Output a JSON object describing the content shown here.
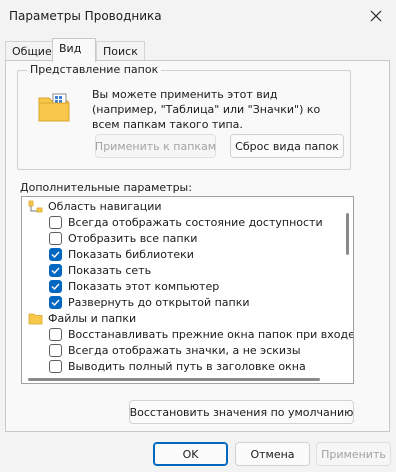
{
  "window": {
    "title": "Параметры Проводника",
    "close_icon": "close-icon"
  },
  "tabs": [
    {
      "label": "Общие",
      "active": false
    },
    {
      "label": "Вид",
      "active": true
    },
    {
      "label": "Поиск",
      "active": false
    }
  ],
  "folder_view": {
    "group_title": "Представление папок",
    "description": "Вы можете применить этот вид (например, \"Таблица\" или \"Значки\") ко всем папкам такого типа.",
    "apply_label": "Применить к папкам",
    "reset_label": "Сброс вида папок",
    "icon": "folder-view-icon"
  },
  "advanced": {
    "label": "Дополнительные параметры:",
    "items": [
      {
        "type": "group",
        "text": "Область навигации",
        "icon": "nav-pane-icon"
      },
      {
        "type": "checkbox",
        "text": "Всегда отображать состояние доступности",
        "checked": false
      },
      {
        "type": "checkbox",
        "text": "Отобразить все папки",
        "checked": false
      },
      {
        "type": "checkbox",
        "text": "Показать библиотеки",
        "checked": true
      },
      {
        "type": "checkbox",
        "text": "Показать сеть",
        "checked": true
      },
      {
        "type": "checkbox",
        "text": "Показать этот компьютер",
        "checked": true
      },
      {
        "type": "checkbox",
        "text": "Развернуть до открытой папки",
        "checked": true
      },
      {
        "type": "group",
        "text": "Файлы и папки",
        "icon": "folder-icon"
      },
      {
        "type": "checkbox",
        "text": "Восстанавливать прежние окна папок при входе в си",
        "checked": false
      },
      {
        "type": "checkbox",
        "text": "Всегда отображать значки, а не эскизы",
        "checked": false
      },
      {
        "type": "checkbox",
        "text": "Выводить полный путь в заголовке окна",
        "checked": false
      }
    ],
    "restore_defaults_label": "Восстановить значения по умолчанию"
  },
  "footer": {
    "ok_label": "OK",
    "cancel_label": "Отмена",
    "apply_label": "Применить"
  },
  "colors": {
    "accent": "#0067c0",
    "folder": "#f8c84a"
  }
}
